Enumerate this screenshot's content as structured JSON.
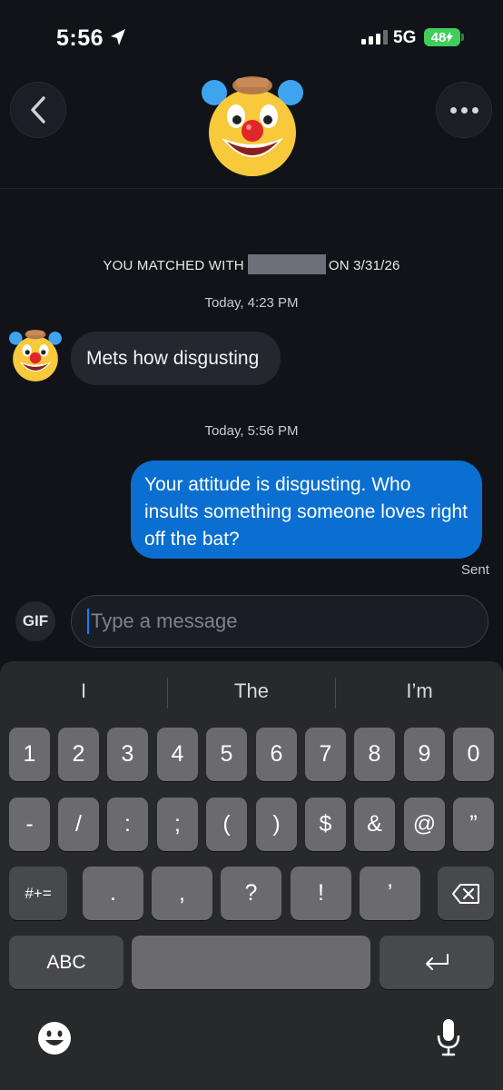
{
  "status": {
    "time": "5:56",
    "network": "5G",
    "battery": "48"
  },
  "header": {},
  "chat": {
    "match_prefix": "YOU MATCHED WITH",
    "match_suffix": "ON 3/31/26",
    "timestamp_1": "Today, 4:23 PM",
    "incoming_message": "Mets how disgusting",
    "timestamp_2": "Today, 5:56 PM",
    "outgoing_message": "Your attitude is disgusting. Who insults something someone loves right off the bat?",
    "sent_status": "Sent"
  },
  "composer": {
    "gif_label": "GIF",
    "placeholder": "Type a message"
  },
  "keyboard": {
    "suggestions": [
      "I",
      "The",
      "I’m"
    ],
    "row1": [
      "1",
      "2",
      "3",
      "4",
      "5",
      "6",
      "7",
      "8",
      "9",
      "0"
    ],
    "row2": [
      "-",
      "/",
      ":",
      ";",
      "(",
      ")",
      "$",
      "&",
      "@",
      "”"
    ],
    "row3": [
      "#+=",
      ".",
      ",",
      "?",
      "!",
      "’"
    ],
    "abc_label": "ABC"
  },
  "icons": [
    "location-arrow-icon",
    "back-chevron-icon",
    "more-dots-icon",
    "clown-face-icon",
    "backspace-icon",
    "return-icon",
    "emoji-icon",
    "microphone-icon"
  ],
  "colors": {
    "outgoing_bubble": "#0a6fd0",
    "incoming_bubble": "#24272e",
    "battery": "#3fce5a",
    "caret": "#0a84ff"
  }
}
